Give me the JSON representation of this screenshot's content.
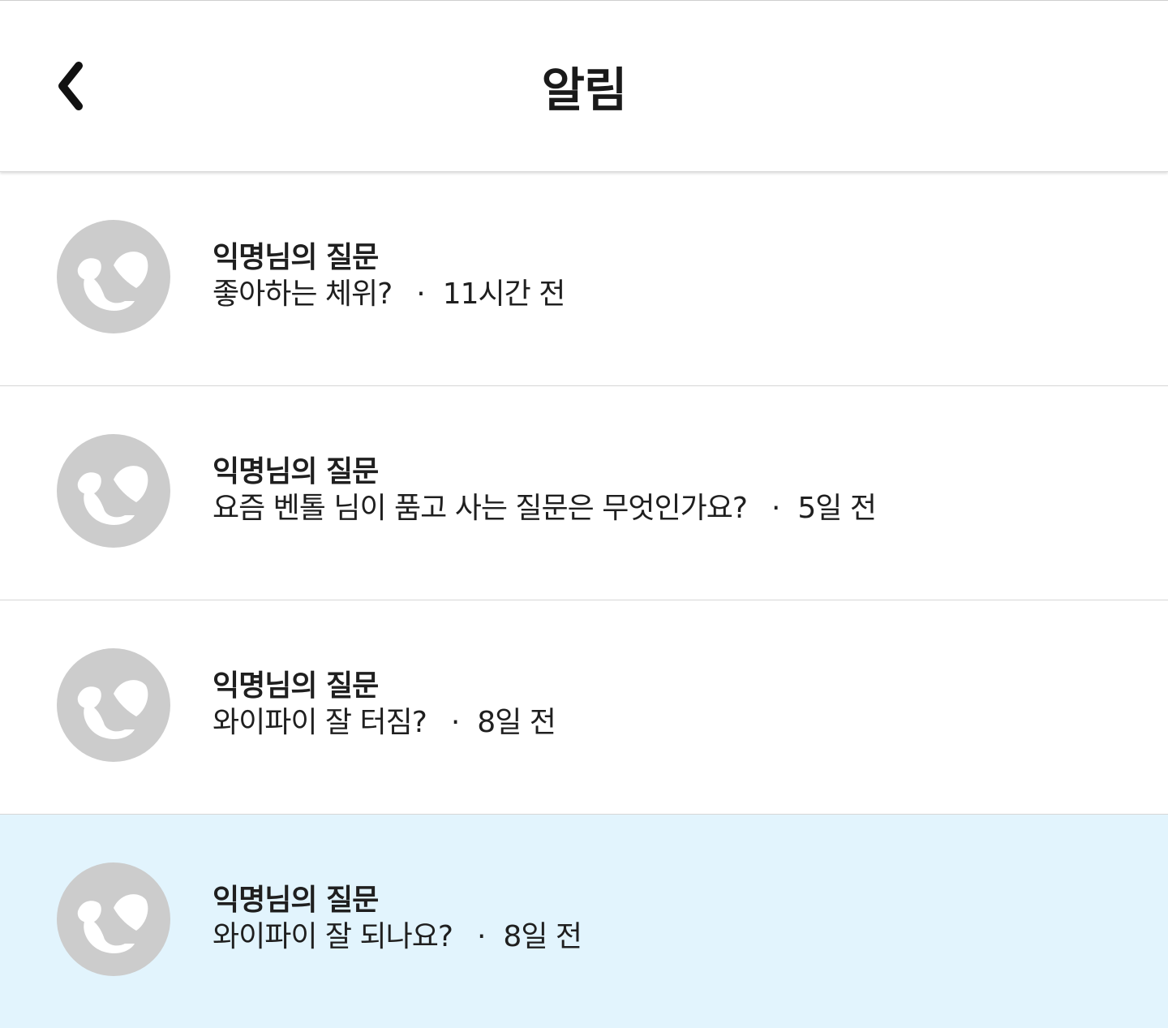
{
  "header": {
    "title": "알림",
    "back_icon": "chevron-left-icon"
  },
  "colors": {
    "unread_background": "#e2f4fd",
    "avatar_gray": "#cccccc"
  },
  "notifications": [
    {
      "title": "익명님의 질문",
      "question": "좋아하는 체위?",
      "separator": "·",
      "time": "11시간 전",
      "unread": false
    },
    {
      "title": "익명님의 질문",
      "question": "요즘 벤톨 님이 품고 사는 질문은 무엇인가요?",
      "separator": "·",
      "time": "5일 전",
      "unread": false
    },
    {
      "title": "익명님의 질문",
      "question": "와이파이 잘 터짐?",
      "separator": "·",
      "time": "8일 전",
      "unread": false
    },
    {
      "title": "익명님의 질문",
      "question": "와이파이 잘 되나요?",
      "separator": "·",
      "time": "8일 전",
      "unread": true
    }
  ]
}
